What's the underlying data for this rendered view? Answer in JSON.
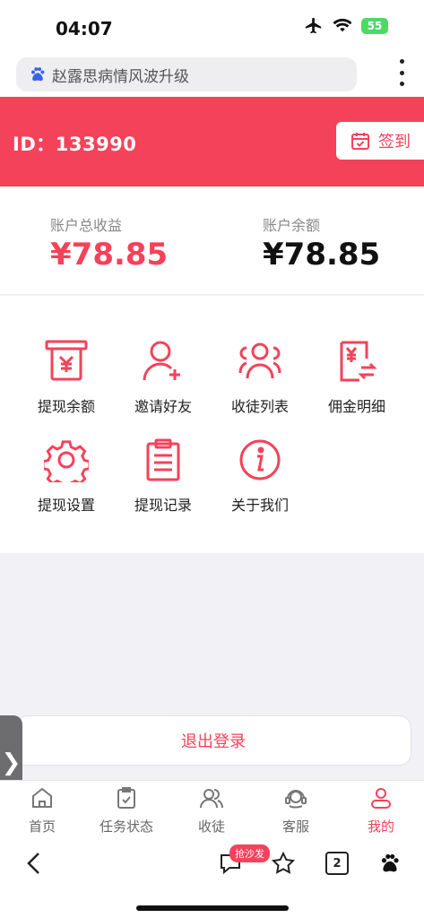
{
  "status": {
    "time": "04:07",
    "battery": "55"
  },
  "browser": {
    "url_text": "赵露思病情风波升级"
  },
  "banner": {
    "id_text": "ID：133990",
    "signin_label": "签到"
  },
  "balance": {
    "total_label": "账户总收益",
    "total_value": "¥78.85",
    "balance_label": "账户余额",
    "balance_value": "¥78.85"
  },
  "grid": {
    "items": [
      {
        "label": "提现余额",
        "icon": "atm-withdraw-icon"
      },
      {
        "label": "邀请好友",
        "icon": "add-user-icon"
      },
      {
        "label": "收徒列表",
        "icon": "group-icon"
      },
      {
        "label": "佣金明细",
        "icon": "commission-icon"
      },
      {
        "label": "提现设置",
        "icon": "gear-icon"
      },
      {
        "label": "提现记录",
        "icon": "clipboard-icon"
      },
      {
        "label": "关于我们",
        "icon": "info-icon"
      }
    ]
  },
  "logout": {
    "label": "退出登录"
  },
  "side_tab": {
    "glyph": "❯"
  },
  "tabs": {
    "items": [
      {
        "label": "首页",
        "icon": "home-icon"
      },
      {
        "label": "任务状态",
        "icon": "task-icon"
      },
      {
        "label": "收徒",
        "icon": "users-icon"
      },
      {
        "label": "客服",
        "icon": "headset-icon"
      },
      {
        "label": "我的",
        "icon": "profile-icon",
        "active": true
      }
    ]
  },
  "toolbar": {
    "comment_badge": "抢沙发",
    "tab_count": "2"
  },
  "colors": {
    "accent": "#f4425a",
    "battery": "#4cd964"
  }
}
